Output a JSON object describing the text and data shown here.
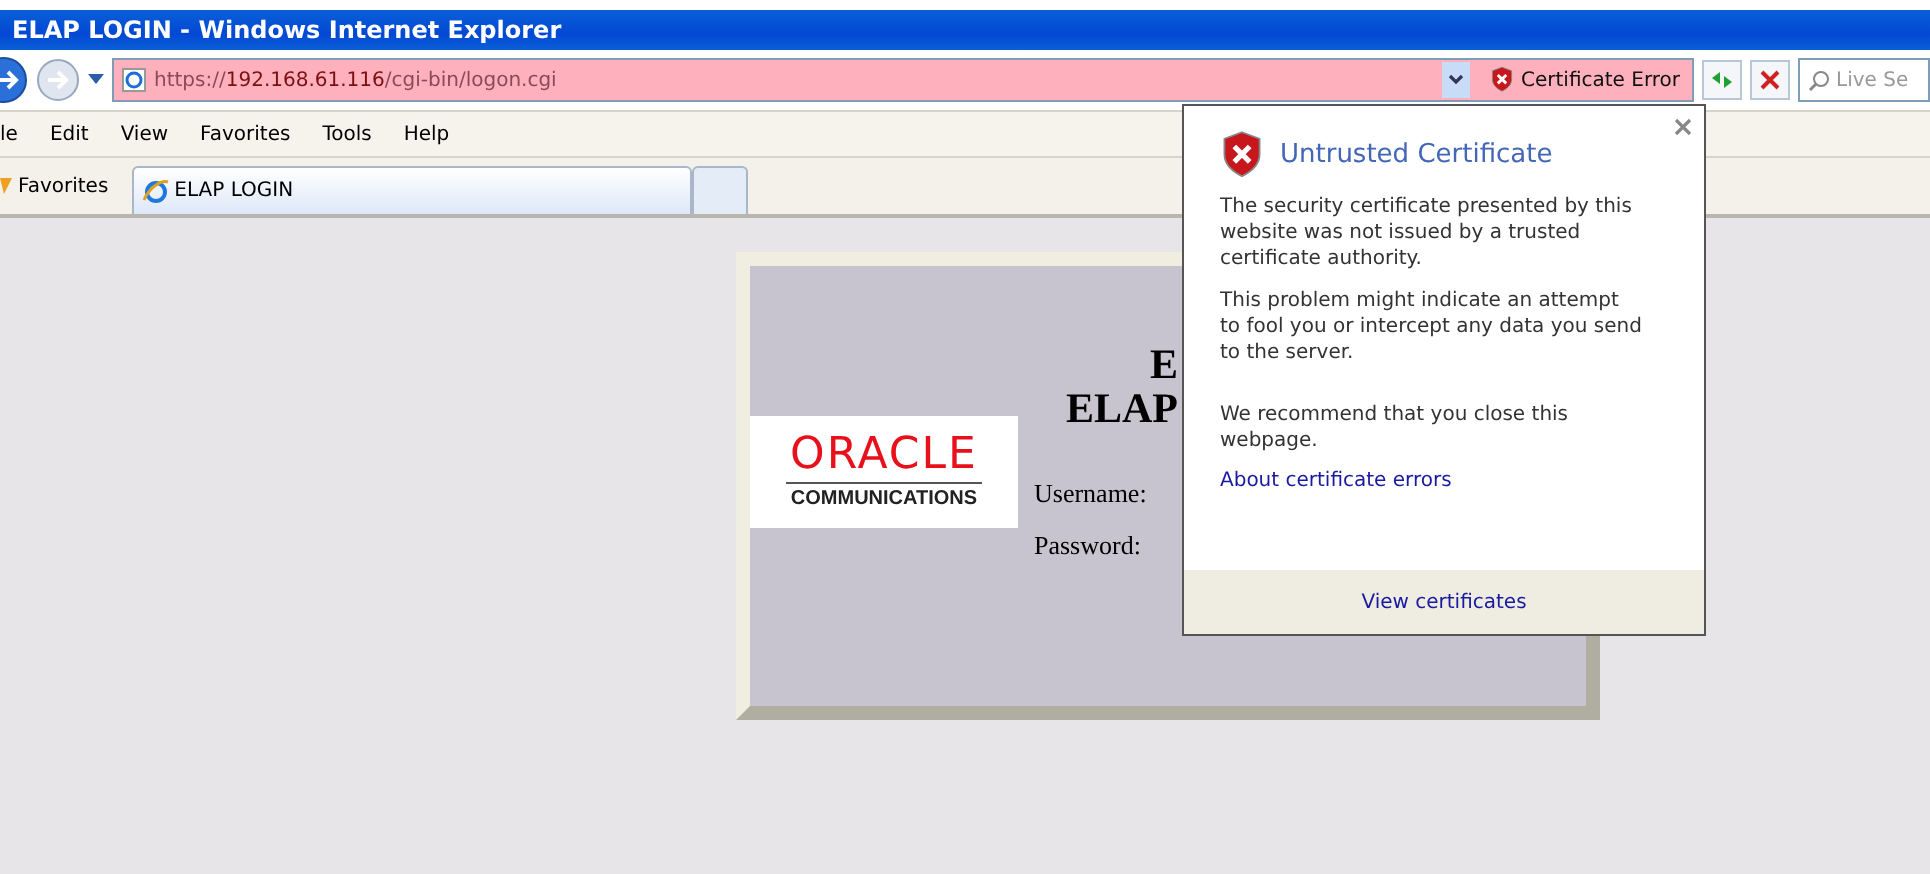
{
  "window": {
    "title": "ELAP LOGIN - Windows Internet Explorer"
  },
  "address_bar": {
    "url_scheme": "https://",
    "url_host": "192.168.61.116",
    "url_path": "/cgi-bin/logon.cgi",
    "certificate_error": "Certificate Error",
    "search_placeholder": "Live Se"
  },
  "menu": [
    "le",
    "Edit",
    "View",
    "Favorites",
    "Tools",
    "Help"
  ],
  "favorites": "Favorites",
  "tabs": [
    {
      "label": "ELAP LOGIN",
      "selected": true
    },
    {
      "selected": false
    }
  ],
  "login": {
    "heading": [
      "E",
      "ELAP"
    ],
    "fields": [
      {
        "label": "Username:"
      },
      {
        "label": "Password:"
      }
    ],
    "logo_brand": "ORACLE",
    "logo_sub": "COMMUNICATIONS"
  },
  "popup": {
    "title": "Untrusted Certificate",
    "paragraphs": [
      "The security certificate presented by this website was not issued by a trusted certificate authority.",
      "This problem might indicate an attempt to fool you or intercept any data you send to the server.",
      "We recommend that you close this webpage."
    ],
    "link": "About certificate errors",
    "footer": "View certificates"
  }
}
